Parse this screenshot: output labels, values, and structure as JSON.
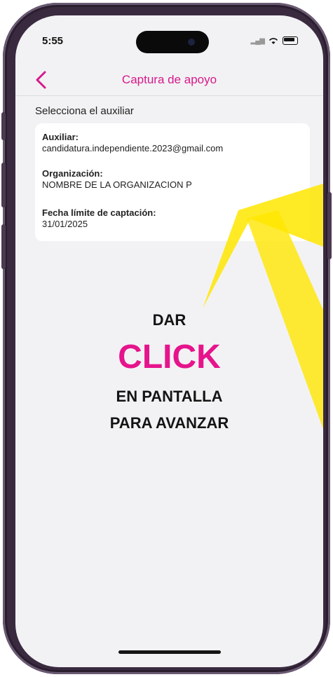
{
  "status_bar": {
    "time": "5:55"
  },
  "navbar": {
    "back_icon": "chevron-left-icon",
    "title": "Captura de apoyo"
  },
  "section_label": "Selecciona el auxiliar",
  "card": {
    "auxiliar_label": "Auxiliar:",
    "auxiliar_value": "candidatura.independiente.2023@gmail.com",
    "organizacion_label": "Organización:",
    "organizacion_value": "NOMBRE DE LA ORGANIZACION P",
    "fecha_label": "Fecha límite de captación:",
    "fecha_value": "31/01/2025"
  },
  "overlay": {
    "line1": "DAR",
    "line2": "CLICK",
    "line3": "EN PANTALLA",
    "line4": "PARA AVANZAR"
  },
  "colors": {
    "accent": "#d6198a",
    "highlight": "#ffe600",
    "click_text": "#e6148c"
  }
}
